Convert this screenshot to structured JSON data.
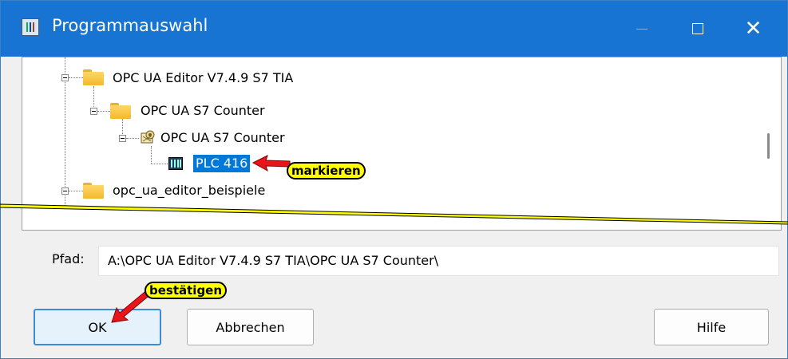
{
  "window": {
    "title": "Programmauswahl",
    "title_bar_color": "#1874d2"
  },
  "tree": {
    "nodes": [
      {
        "label": "OPC UA Editor V7.4.9 S7 TIA",
        "icon": "folder-icon",
        "expanded": true
      },
      {
        "label": "OPC UA S7 Counter",
        "icon": "folder-icon",
        "expanded": true
      },
      {
        "label": "OPC UA S7 Counter",
        "icon": "project-icon",
        "expanded": true
      },
      {
        "label": "PLC 416",
        "icon": "plc-icon",
        "selected": true
      },
      {
        "label": "opc_ua_editor_beispiele",
        "icon": "folder-icon",
        "expanded": true
      }
    ]
  },
  "path": {
    "label": "Pfad:",
    "value": "A:\\OPC UA Editor V7.4.9 S7 TIA\\OPC UA S7 Counter\\"
  },
  "buttons": {
    "ok": "OK",
    "cancel": "Abbrechen",
    "help": "Hilfe"
  },
  "annotations": {
    "select_hint": "markieren",
    "confirm_hint": "bestätigen",
    "highlight_color": "#ffff00",
    "arrow_color": "#e8141c",
    "selection_color": "#0078d7"
  }
}
